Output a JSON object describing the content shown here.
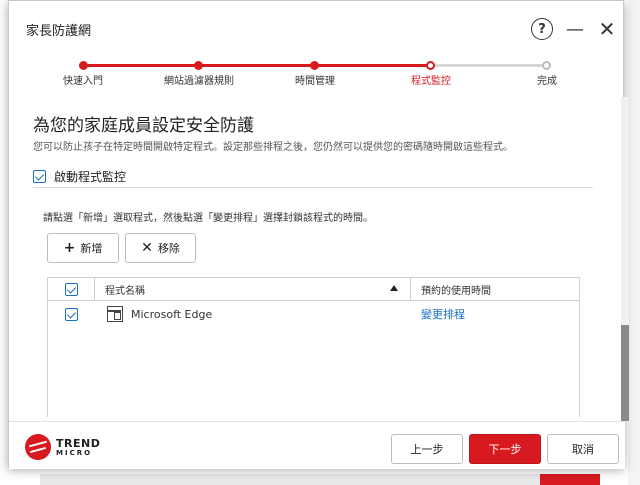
{
  "window": {
    "title": "家長防護網",
    "help_label": "?",
    "minimize_label": "—",
    "close_label": "✕"
  },
  "steps": [
    {
      "label": "快速入門",
      "state": "done"
    },
    {
      "label": "網站過濾器規則",
      "state": "done"
    },
    {
      "label": "時間管理",
      "state": "done"
    },
    {
      "label": "程式監控",
      "state": "current"
    },
    {
      "label": "完成",
      "state": "todo"
    }
  ],
  "main": {
    "heading": "為您的家庭成員設定安全防護",
    "subheading": "您可以防止孩子在特定時間開啟特定程式。設定那些排程之後，您仍然可以提供您的密碼隨時開啟這些程式。",
    "enable_label": "啟動程式監控",
    "enable_checked": true,
    "instruction": "請點選「新增」選取程式，然後點選「變更排程」選擇封鎖該程式的時間。",
    "add_label": "新增",
    "remove_label": "移除"
  },
  "table": {
    "columns": {
      "name": "程式名稱",
      "time": "預約的使用時間"
    },
    "rows": [
      {
        "checked": true,
        "name": "Microsoft Edge",
        "action": "變更排程"
      }
    ]
  },
  "footer": {
    "logo_line1": "TREND",
    "logo_line2": "MICRO",
    "prev_label": "上一步",
    "next_label": "下一步",
    "cancel_label": "取消"
  },
  "colors": {
    "accent": "#d71920",
    "link": "#1a6fc4"
  }
}
